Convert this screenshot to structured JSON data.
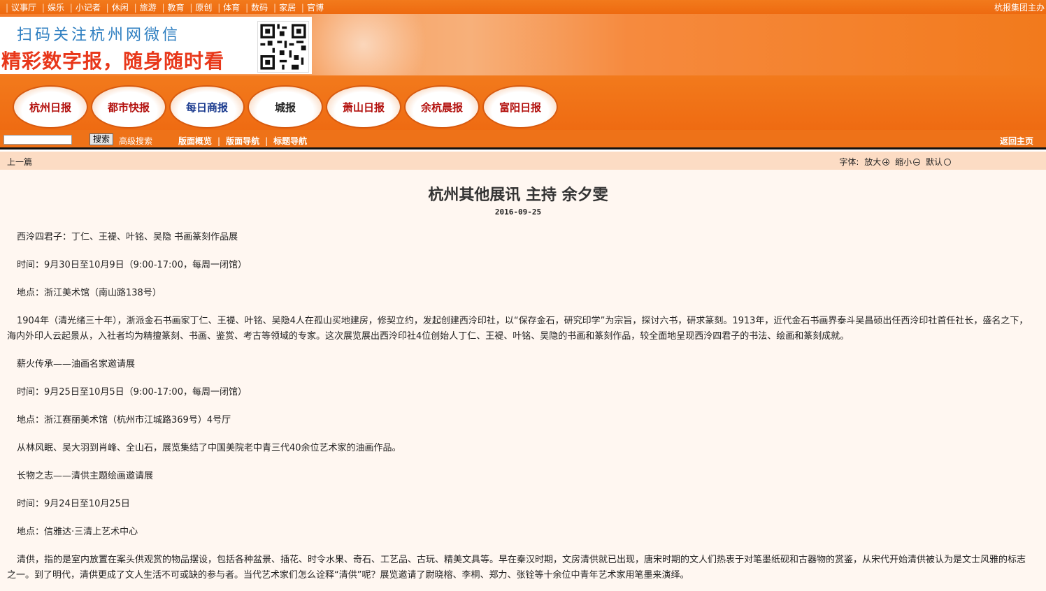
{
  "topnav": {
    "links": [
      "议事厅",
      "娱乐",
      "小记者",
      "休闲",
      "旅游",
      "教育",
      "原创",
      "体育",
      "数码",
      "家居",
      "官博"
    ],
    "owner": "杭报集团主办"
  },
  "banner": {
    "line1": "扫码关注杭州网微信",
    "line2": "精彩数字报，随身随时看"
  },
  "logos": [
    "杭州日报",
    "都市快报",
    "每日商报",
    "城报",
    "萧山日报",
    "余杭晨报",
    "富阳日报"
  ],
  "search": {
    "button": "搜索",
    "advanced": "高级搜索",
    "nav": [
      "版面概览",
      "版面导航",
      "标题导航"
    ],
    "home": "返回主页"
  },
  "toolbar": {
    "prev": "上一篇",
    "font_label": "字体:",
    "enlarge": "放大",
    "shrink": "缩小",
    "default": "默认"
  },
  "article": {
    "title": "杭州其他展讯 主持 余夕雯",
    "date": "2016-09-25",
    "paragraphs": [
      "西泠四君子：丁仁、王褆、叶铭、吴隐 书画篆刻作品展",
      "时间：9月30日至10月9日（9:00-17:00，每周一闭馆）",
      "地点：浙江美术馆（南山路138号）",
      "1904年（清光绪三十年），浙派金石书画家丁仁、王褆、叶铭、吴隐4人在孤山买地建房，修契立约，发起创建西泠印社，以“保存金石，研究印学”为宗旨，探讨六书，研求篆刻。1913年，近代金石书画界泰斗吴昌硕出任西泠印社首任社长，盛名之下，海内外印人云起景从，入社者均为精擅篆刻、书画、鉴赏、考古等领域的专家。这次展览展出西泠印社4位创始人丁仁、王褆、叶铭、吴隐的书画和篆刻作品，较全面地呈现西泠四君子的书法、绘画和篆刻成就。",
      "薪火传承——油画名家邀请展",
      "时间：9月25日至10月5日（9:00-17:00，每周一闭馆）",
      "地点：浙江赛丽美术馆（杭州市江城路369号）4号厅",
      "从林风眠、吴大羽到肖峰、全山石，展览集结了中国美院老中青三代40余位艺术家的油画作品。",
      "长物之志——清供主题绘画邀请展",
      "时间：9月24日至10月25日",
      "地点：信雅达·三清上艺术中心",
      "清供，指的是室内放置在案头供观赏的物品摆设，包括各种盆景、插花、时令水果、奇石、工艺品、古玩、精美文具等。早在秦汉时期，文房清供就已出现，唐宋时期的文人们热衷于对笔墨纸砚和古器物的赏鉴，从宋代开始清供被认为是文士风雅的标志之一。到了明代，清供更成了文人生活不可或缺的参与者。当代艺术家们怎么诠释“清供”呢？展览邀请了尉晓榕、李桐、郑力、张铨等十余位中青年艺术家用笔墨来演绎。"
    ]
  }
}
